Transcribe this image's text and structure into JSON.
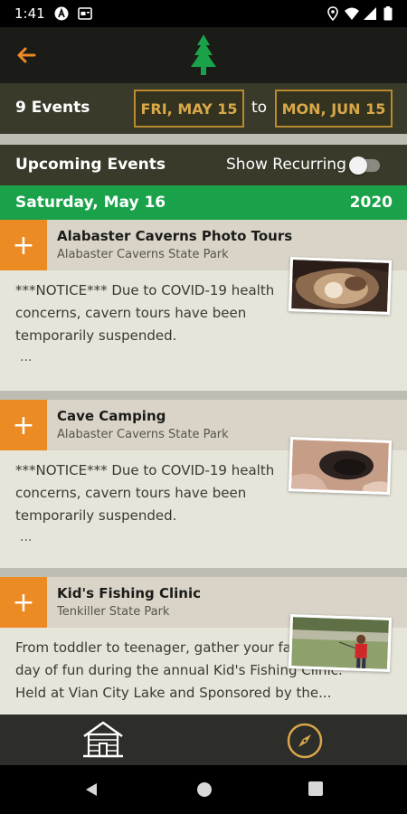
{
  "status_bar": {
    "time": "1:41",
    "icons": [
      "a-circle-icon",
      "message-icon",
      "location-icon",
      "wifi-icon",
      "signal-icon",
      "battery-icon"
    ]
  },
  "app_bar": {
    "back_icon": "back-arrow-icon",
    "logo": "pine-tree-logo"
  },
  "date_filter": {
    "count_label": "9 Events",
    "start_date": "FRI, MAY 15",
    "to_label": "to",
    "end_date": "MON, JUN 15"
  },
  "section": {
    "title": "Upcoming Events",
    "recurring_label": "Show Recurring",
    "recurring_on": false
  },
  "day_header": {
    "day": "Saturday, May 16",
    "year": "2020"
  },
  "events": [
    {
      "name": "Alabaster Caverns Photo Tours",
      "park": "Alabaster Caverns State Park",
      "description": "***NOTICE*** Due to COVID-19 health concerns, cavern tours have been temporarily suspended.",
      "ellipsis": "...",
      "add_label": "+"
    },
    {
      "name": "Cave Camping",
      "park": "Alabaster Caverns State Park",
      "description": "***NOTICE*** Due to COVID-19 health concerns, cavern tours have been temporarily suspended.",
      "ellipsis": "...",
      "add_label": "+"
    },
    {
      "name": "Kid's Fishing Clinic",
      "park": "Tenkiller State Park",
      "description": "From toddler to teenager, gather your family for a day of fun during the annual Kid's Fishing Clinic. Held at Vian City Lake and Sponsored by the...",
      "add_label": "+"
    }
  ],
  "bottom_nav": {
    "items": [
      "home-lodge-icon",
      "compass-icon"
    ]
  },
  "colors": {
    "accent_orange": "#ec8a24",
    "day_green": "#1aa24a",
    "gold_border": "#b98a2e",
    "bar_dark": "#3a3a2a"
  }
}
